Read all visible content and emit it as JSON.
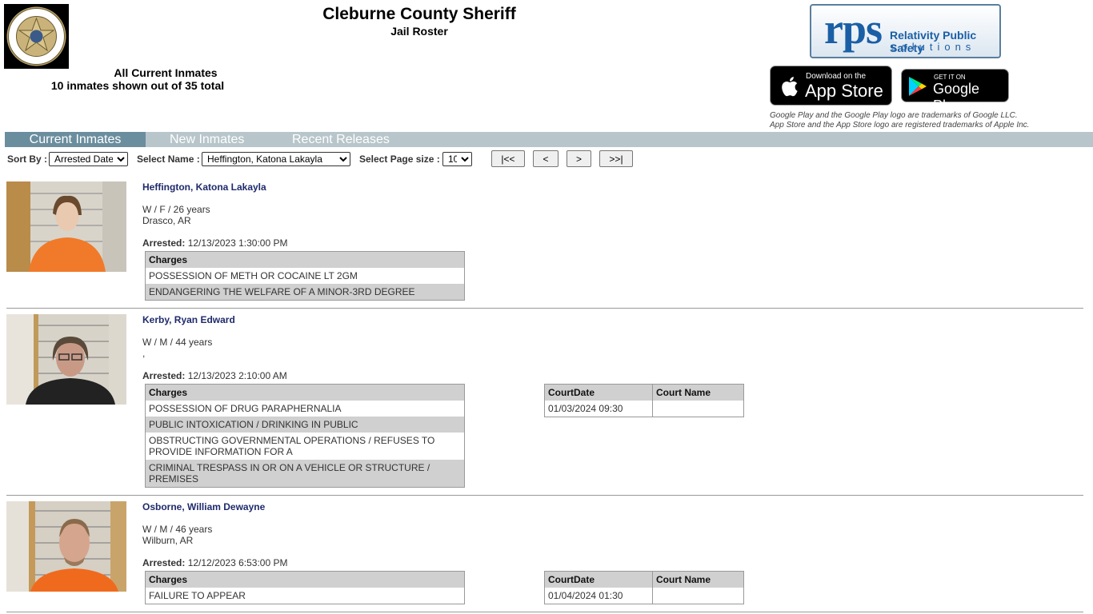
{
  "header": {
    "title": "Cleburne County Sheriff",
    "subtitle": "Jail Roster",
    "all_inmates": "All Current Inmates",
    "count_text": "10 inmates shown out of 35 total"
  },
  "badge": {
    "top_text": "SHERIFF'S OFFICE",
    "bottom_text": "CLEBURNE COUNTY",
    "inner_top": "TO PROTECT",
    "inner_bottom": "AND SERVE"
  },
  "rps_logo": {
    "mark": "rps",
    "line1": "Relativity Public Safety",
    "line2": "solutions"
  },
  "app_store": {
    "small": "Download on the",
    "big": "App Store"
  },
  "google_play": {
    "small": "GET IT ON",
    "big": "Google Play"
  },
  "trademark_note": {
    "line1": "Google Play and the Google Play logo are trademarks of Google LLC.",
    "line2": "App Store and the App Store logo are registered trademarks of Apple Inc."
  },
  "tabs": [
    {
      "label": "Current Inmates",
      "active": true
    },
    {
      "label": "New Inmates",
      "active": false
    },
    {
      "label": "Recent Releases",
      "active": false
    }
  ],
  "controls": {
    "sort_label": "Sort By :",
    "sort_value": "Arrested Date",
    "name_label": "Select Name :",
    "name_value": "Heffington, Katona Lakayla",
    "page_size_label": "Select Page size :",
    "page_size_value": "10",
    "first": "|<<",
    "prev": "<",
    "next": ">",
    "last": ">>|"
  },
  "labels": {
    "arrested": "Arrested:",
    "charges": "Charges",
    "court_date": "CourtDate",
    "court_name": "Court Name"
  },
  "inmates": [
    {
      "name": "Heffington, Katona Lakayla",
      "demographics": "W / F / 26 years",
      "location": "Drasco, AR",
      "arrested": "12/13/2023 1:30:00 PM",
      "charges": [
        "POSSESSION OF METH OR COCAINE LT 2GM",
        "ENDANGERING THE WELFARE OF A MINOR-3RD DEGREE"
      ]
    },
    {
      "name": "Kerby, Ryan Edward",
      "demographics": "W / M / 44 years",
      "location": ",",
      "arrested": "12/13/2023 2:10:00 AM",
      "charges": [
        "POSSESSION OF DRUG PARAPHERNALIA",
        "PUBLIC INTOXICATION / DRINKING IN PUBLIC",
        "OBSTRUCTING GOVERNMENTAL OPERATIONS / REFUSES TO PROVIDE INFORMATION FOR A",
        "CRIMINAL TRESPASS IN OR ON A VEHICLE OR STRUCTURE / PREMISES"
      ],
      "court": {
        "date": "01/03/2024 09:30",
        "name": ""
      }
    },
    {
      "name": "Osborne, William Dewayne",
      "demographics": "W / M / 46 years",
      "location": "Wilburn, AR",
      "arrested": "12/12/2023 6:53:00 PM",
      "charges": [
        "FAILURE TO APPEAR"
      ],
      "court": {
        "date": "01/04/2024 01:30",
        "name": ""
      }
    }
  ],
  "colors": {
    "tab_bar": "#b8c6cb",
    "tab_active": "#6b8e9e",
    "name_link": "#1f2a6b",
    "table_header": "#d0d0d0"
  }
}
